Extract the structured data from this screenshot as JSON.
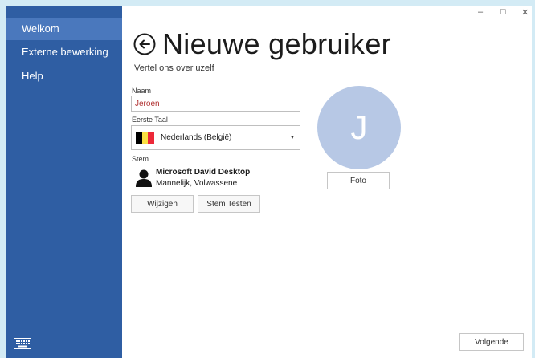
{
  "sidebar": {
    "items": [
      {
        "label": "Welkom",
        "active": true
      },
      {
        "label": "Externe bewerking",
        "active": false
      },
      {
        "label": "Help",
        "active": false
      }
    ],
    "accent": "#2f5ea3",
    "active_bg": "#4a78bd",
    "bottom_icon": "keyboard-icon"
  },
  "window_controls": {
    "minimize": "–",
    "maximize": "□",
    "close": "✕"
  },
  "header": {
    "back_icon": "back-arrow-icon",
    "title": "Nieuwe gebruiker",
    "subtitle": "Vertel ons over uzelf"
  },
  "form": {
    "name_label": "Naam",
    "name_value": "Jeroen",
    "language_label": "Eerste Taal",
    "language_value": "Nederlands (België)",
    "language_flag_colors": [
      "#000000",
      "#fae042",
      "#ed2939"
    ],
    "voice_label": "Stem",
    "voice_name": "Microsoft David Desktop",
    "voice_description": "Mannelijk, Volwassene",
    "change_button": "Wijzigen",
    "test_button": "Stem Testen"
  },
  "avatar": {
    "initial": "J",
    "color": "#b7c8e5",
    "photo_button": "Foto"
  },
  "footer": {
    "next_button": "Volgende"
  }
}
